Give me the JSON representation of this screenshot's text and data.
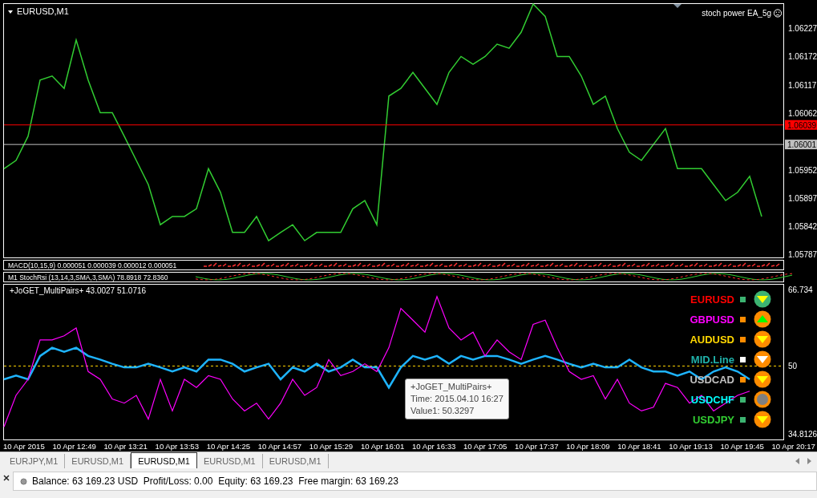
{
  "chart_window": {
    "symbol": "EURUSD,M1",
    "expert": "stoch power EA_5g"
  },
  "price_chart": {
    "chart_data": {
      "type": "line",
      "ylim": [
        1.05783,
        1.06274
      ],
      "yticks": [
        1.05787,
        1.05842,
        1.05897,
        1.05952,
        1.06062,
        1.06117,
        1.06172,
        1.06227
      ],
      "series": [
        {
          "color": "#32cd32",
          "values": [
            1.05954,
            1.0597,
            1.06017,
            1.06126,
            1.06134,
            1.0611,
            1.06204,
            1.06126,
            1.06063,
            1.06063,
            1.06017,
            1.0597,
            1.05923,
            1.05845,
            1.05861,
            1.05861,
            1.05876,
            1.05954,
            1.05908,
            1.0583,
            1.0583,
            1.05861,
            1.05814,
            1.0583,
            1.05845,
            1.05814,
            1.0583,
            1.0583,
            1.0583,
            1.05876,
            1.05892,
            1.05845,
            1.06095,
            1.0611,
            1.06141,
            1.0611,
            1.06079,
            1.06141,
            1.06172,
            1.06157,
            1.06172,
            1.06196,
            1.06188,
            1.06219,
            1.06274,
            1.0625,
            1.06172,
            1.06172,
            1.06134,
            1.06079,
            1.06095,
            1.06032,
            1.05986,
            1.0597,
            1.06001,
            1.06032,
            1.05954,
            1.05954,
            1.05954,
            1.05923,
            1.05892,
            1.05908,
            1.05939,
            1.05861
          ]
        }
      ],
      "ref_lines": [
        {
          "axis": "y",
          "value": 1.06039,
          "label": "1.06039",
          "color": "#ff0000"
        },
        {
          "axis": "y",
          "value": 1.06001,
          "label": "1.06001",
          "color": "#c0c0c0"
        }
      ]
    }
  },
  "macd_panel": {
    "label": "MACD(10,15,9) 0.000051 0.000039 0.000012 0.000051"
  },
  "stoch_panel": {
    "label": "M1  StochRsi (13,14,3,SMA,3,SMA) 78.8918 72.8360"
  },
  "indicator_panel": {
    "label": "+JoGET_MultiPairs+ 43.0027 51.0716",
    "chart_data": {
      "type": "line",
      "ylim": [
        34.13,
        67.77
      ],
      "yticks": [
        {
          "value": 34.8126,
          "label": "34.8126"
        },
        {
          "value": 50,
          "label": "50"
        },
        {
          "value": 66.734,
          "label": "66.734"
        }
      ],
      "series": [
        {
          "color": "#1eb4ff",
          "values": [
            47.1,
            47.9,
            47.1,
            52.2,
            54.0,
            53.1,
            54.0,
            52.2,
            51.4,
            50.5,
            49.7,
            49.7,
            50.5,
            49.7,
            48.8,
            49.7,
            48.8,
            51.4,
            51.4,
            50.5,
            48.8,
            49.7,
            50.5,
            47.1,
            49.7,
            48.8,
            50.5,
            48.8,
            49.7,
            51.4,
            49.7,
            49.7,
            45.3,
            49.7,
            52.2,
            51.4,
            52.2,
            50.5,
            52.2,
            51.4,
            52.2,
            52.2,
            51.4,
            50.5,
            51.4,
            52.2,
            51.4,
            50.5,
            49.7,
            50.5,
            49.7,
            49.7,
            51.4,
            49.7,
            48.8,
            48.8,
            47.9,
            48.8,
            47.1,
            48.8,
            49.7,
            48.8,
            47.1,
            null,
            null
          ]
        },
        {
          "color": "#ff00ff",
          "values": [
            36.7,
            43.6,
            47.1,
            55.7,
            55.7,
            56.6,
            58.3,
            48.8,
            47.1,
            42.8,
            41.9,
            43.6,
            38.4,
            47.1,
            40.2,
            47.1,
            45.3,
            47.9,
            47.1,
            42.8,
            40.2,
            41.9,
            38.4,
            41.9,
            47.1,
            43.6,
            45.3,
            51.4,
            47.9,
            48.8,
            50.5,
            48.8,
            54.0,
            62.6,
            60.0,
            57.4,
            65.2,
            58.3,
            55.7,
            57.4,
            52.2,
            55.7,
            53.1,
            51.4,
            59.1,
            60.0,
            54.0,
            48.8,
            47.1,
            47.9,
            42.8,
            47.1,
            41.9,
            40.2,
            41.0,
            46.2,
            45.3,
            41.9,
            43.6,
            40.2,
            41.9,
            43.6,
            44.5,
            null,
            null
          ]
        }
      ],
      "ref_lines": [
        {
          "axis": "y",
          "value": 50,
          "color": "#ffd700"
        }
      ]
    },
    "legend": [
      {
        "name": "EURUSD",
        "color": "#ff0000",
        "square": {
          "color": "#3cb371"
        },
        "badge": {
          "kind": "down",
          "color": "#3cb371",
          "arrow": {
            "color": "#ffff00"
          }
        }
      },
      {
        "name": "GBPUSD",
        "color": "#ff00ff",
        "square": {
          "color": "#ff8c00"
        },
        "badge": {
          "kind": "up",
          "color": "#ff8c00",
          "arrow": {
            "color": "#00ff00"
          }
        }
      },
      {
        "name": "AUDUSD",
        "color": "#ffd700",
        "square": {
          "color": "#ff8c00"
        },
        "badge": {
          "kind": "down",
          "color": "#ff8c00",
          "arrow": {
            "color": "#ffff00"
          }
        }
      },
      {
        "name": "MID.Line",
        "color": "#20b2aa",
        "square": {
          "color": "#ffffff"
        },
        "badge": {
          "kind": "down",
          "color": "#ff8c00",
          "arrow": {
            "color": "#ffffff"
          }
        }
      },
      {
        "name": "USDCAD",
        "color": "#c0c0c0",
        "square": {
          "color": "#ff8c00"
        },
        "badge": {
          "kind": "down",
          "color": "#ff8c00",
          "arrow": {
            "color": "#ffff00"
          }
        }
      },
      {
        "name": "USDCHF",
        "color": "#00ffff",
        "square": {
          "color": "#3cb371"
        },
        "badge": {
          "kind": "dot",
          "color": "#ff8c00",
          "arrow": {
            "color": "#808080"
          }
        }
      },
      {
        "name": "USDJPY",
        "color": "#32cd32",
        "square": {
          "color": "#3cb371"
        },
        "badge": {
          "kind": "down",
          "color": "#ff8c00",
          "arrow": {
            "color": "#ffff00"
          }
        }
      }
    ],
    "tooltip": {
      "title": "+JoGET_MultiPairs+",
      "lines": [
        "Time: 2015.04.10 16:27",
        "Value1: 50.3297"
      ]
    }
  },
  "time_axis": [
    "10 Apr 2015",
    "10 Apr 12:49",
    "10 Apr 13:21",
    "10 Apr 13:53",
    "10 Apr 14:25",
    "10 Apr 14:57",
    "10 Apr 15:29",
    "10 Apr 16:01",
    "10 Apr 16:33",
    "10 Apr 17:05",
    "10 Apr 17:37",
    "10 Apr 18:09",
    "10 Apr 18:41",
    "10 Apr 19:13",
    "10 Apr 19:45",
    "10 Apr 20:17"
  ],
  "tabs": [
    {
      "label": "EURJPY,M1",
      "selected": false
    },
    {
      "label": "EURUSD,M1",
      "selected": false
    },
    {
      "label": "EURUSD,M1",
      "selected": true
    },
    {
      "label": "EURUSD,M1",
      "selected": false
    },
    {
      "label": "EURUSD,M1",
      "selected": false
    }
  ],
  "status_bar": {
    "text": "Balance: 63 169.23 USD  Profit/Loss: 0.00  Equity: 63 169.23  Free margin: 63 169.23"
  }
}
